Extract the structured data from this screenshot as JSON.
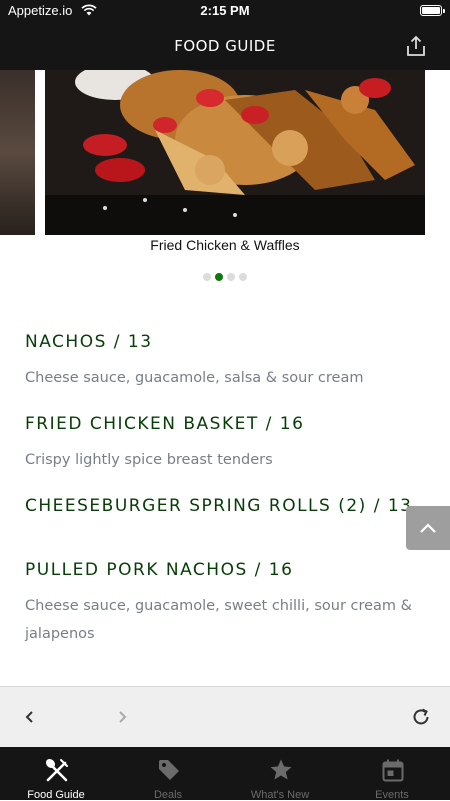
{
  "status_bar": {
    "carrier": "Appetize.io",
    "time": "2:15 PM"
  },
  "nav": {
    "title": "FOOD GUIDE",
    "share_icon": "share-icon"
  },
  "carousel": {
    "caption": "Fried Chicken & Waffles",
    "page_count": 4,
    "active_index": 1
  },
  "menu": {
    "items": [
      {
        "title": "NACHOS / 13",
        "description": "Cheese sauce, guacamole, salsa & sour cream"
      },
      {
        "title": "FRIED CHICKEN BASKET / 16",
        "description": "Crispy lightly spice breast tenders"
      },
      {
        "title": "CHEESEBURGER SPRING ROLLS (2) / 13",
        "description": ""
      },
      {
        "title": "PULLED PORK NACHOS / 16",
        "description": "Cheese sauce, guacamole, sweet chilli, sour cream & jalapenos"
      }
    ]
  },
  "browser": {
    "back_icon": "chevron-left-icon",
    "forward_icon": "chevron-right-icon",
    "reload_icon": "reload-icon"
  },
  "tabs": [
    {
      "label": "Food Guide",
      "icon": "fork-knife-icon",
      "active": true
    },
    {
      "label": "Deals",
      "icon": "tag-icon",
      "active": false
    },
    {
      "label": "What's New",
      "icon": "star-icon",
      "active": false
    },
    {
      "label": "Events",
      "icon": "calendar-icon",
      "active": false
    }
  ],
  "colors": {
    "accent": "#0c7a0c",
    "item_title": "#073d07",
    "bar": "#151515"
  }
}
